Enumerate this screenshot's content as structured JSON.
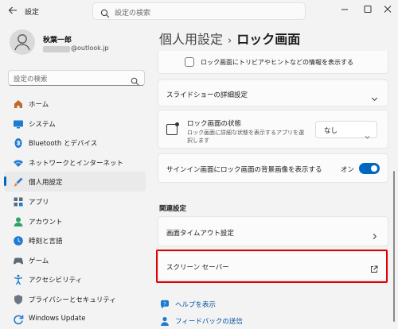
{
  "window": {
    "title": "設定",
    "search_placeholder": "設定の検索"
  },
  "account": {
    "name": "秋葉一郎",
    "email_domain": "@outlook.jp"
  },
  "sidebar": {
    "search_placeholder": "設定の検索",
    "items": [
      {
        "label": "ホーム",
        "icon": "home-icon"
      },
      {
        "label": "システム",
        "icon": "system-icon"
      },
      {
        "label": "Bluetooth とデバイス",
        "icon": "bluetooth-icon"
      },
      {
        "label": "ネットワークとインターネット",
        "icon": "network-icon"
      },
      {
        "label": "個人用設定",
        "icon": "personalization-icon",
        "active": true
      },
      {
        "label": "アプリ",
        "icon": "apps-icon"
      },
      {
        "label": "アカウント",
        "icon": "account-icon"
      },
      {
        "label": "時刻と言語",
        "icon": "time-language-icon"
      },
      {
        "label": "ゲーム",
        "icon": "gaming-icon"
      },
      {
        "label": "アクセシビリティ",
        "icon": "accessibility-icon"
      },
      {
        "label": "プライバシーとセキュリティ",
        "icon": "privacy-icon"
      },
      {
        "label": "Windows Update",
        "icon": "windows-update-icon"
      }
    ]
  },
  "breadcrumb": {
    "parent": "個人用設定",
    "separator": "›",
    "current": "ロック画面"
  },
  "main": {
    "trivia_label": "ロック画面にトリビアやヒントなどの情報を表示する",
    "slideshow_label": "スライドショーの詳細設定",
    "status": {
      "label": "ロック画面の状態",
      "sub": "ロック画面に詳細な状態を表示するアプリを選択します",
      "value": "なし"
    },
    "signin": {
      "label": "サインイン画面にロック画面の背景画像を表示する",
      "toggle_text": "オン",
      "toggle_on": true
    },
    "related_heading": "関連設定",
    "screen_timeout_label": "画面タイムアウト設定",
    "screen_saver_label": "スクリーン セーバー",
    "help_label": "ヘルプを表示",
    "feedback_label": "フィードバックの送信"
  },
  "colors": {
    "accent": "#0067c0",
    "highlight": "#e00000",
    "background": "#f3f3f3"
  }
}
